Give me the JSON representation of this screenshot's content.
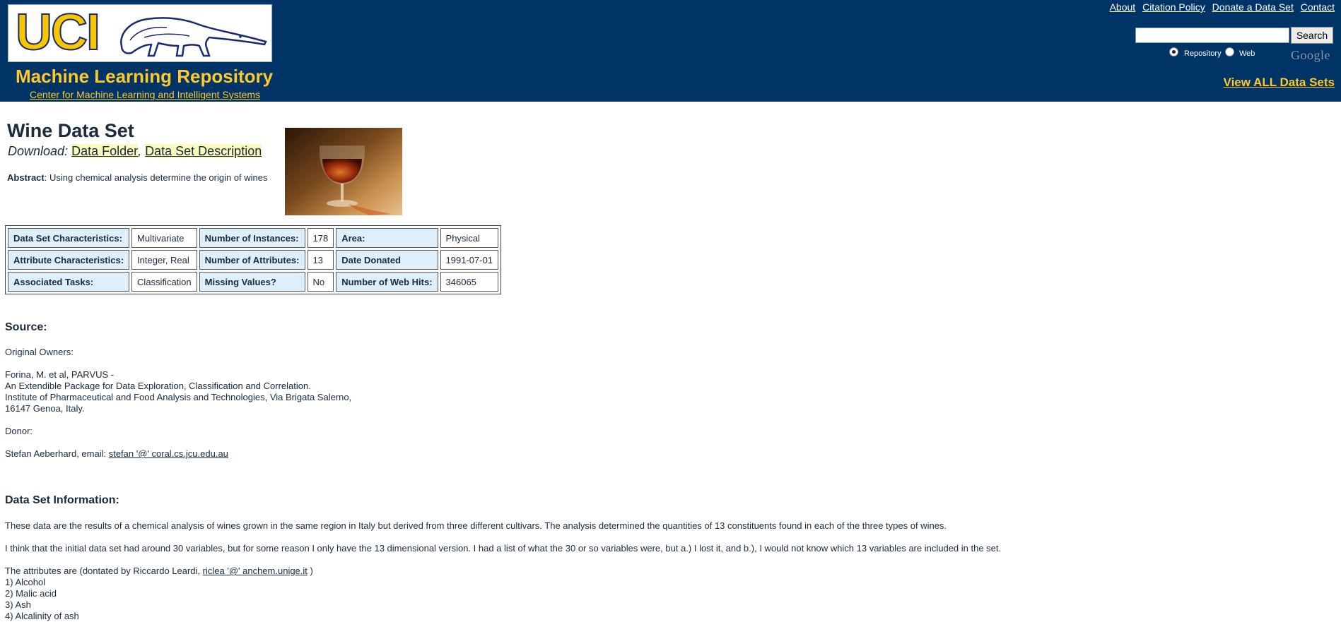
{
  "header": {
    "logo_text": "UCI",
    "repo_title": "Machine Learning Repository",
    "repo_subtitle": "Center for Machine Learning and Intelligent Systems",
    "links": [
      "About",
      "Citation Policy",
      "Donate a Data Set",
      "Contact"
    ],
    "search_value": "",
    "search_button": "Search",
    "radio_options": [
      {
        "label": "Repository",
        "checked": true
      },
      {
        "label": "Web",
        "checked": false
      }
    ],
    "google_logo_text": "Google",
    "view_all": "View ALL Data Sets"
  },
  "dataset": {
    "title": "Wine Data Set",
    "download_label": "Download",
    "download_links": [
      "Data Folder",
      "Data Set Description"
    ],
    "abstract_label": "Abstract",
    "abstract_text": "Using chemical analysis determine the origin of wines",
    "image_icon": "wine-glass-photo"
  },
  "info_table": {
    "rows": [
      [
        "Data Set Characteristics:",
        "Multivariate",
        "Number of Instances:",
        "178",
        "Area:",
        "Physical"
      ],
      [
        "Attribute Characteristics:",
        "Integer, Real",
        "Number of Attributes:",
        "13",
        "Date Donated",
        "1991-07-01"
      ],
      [
        "Associated Tasks:",
        "Classification",
        "Missing Values?",
        "No",
        "Number of Web Hits:",
        "346065"
      ]
    ]
  },
  "source": {
    "heading": "Source:",
    "original_owners": "Original Owners:",
    "owner_lines": [
      "Forina, M. et al, PARVUS -",
      "An Extendible Package for Data Exploration, Classification and Correlation.",
      "Institute of Pharmaceutical and Food Analysis and Technologies, Via Brigata Salerno,",
      "16147 Genoa, Italy."
    ],
    "donor_label": "Donor:",
    "donor_text": "Stefan Aeberhard, email:",
    "donor_email": "stefan '@' coral.cs.jcu.edu.au"
  },
  "information": {
    "heading": "Data Set Information:",
    "p1": "These data are the results of a chemical analysis of wines grown in the same region in Italy but derived from three different cultivars. The analysis determined the quantities of 13 constituents found in each of the three types of wines.",
    "p2": "I think that the initial data set had around 30 variables, but for some reason I only have the 13 dimensional version. I had a list of what the 30 or so variables were, but a.) I lost it, and b.), I would not know which 13 variables are included in the set.",
    "p3_prefix": "The attributes are (dontated by Riccardo Leardi,",
    "p3_email": "riclea '@' anchem.unige.it",
    "p3_suffix": ")",
    "attributes": [
      "1) Alcohol",
      "2) Malic acid",
      "3) Ash",
      "4) Alcalinity of ash"
    ]
  }
}
